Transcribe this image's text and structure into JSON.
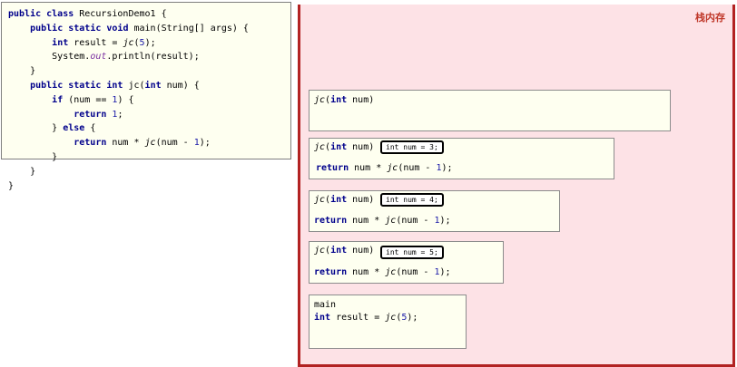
{
  "code": {
    "lines": [
      "public class RecursionDemo1 {",
      "    public static void main(String[] args) {",
      "        int result = jc(5);",
      "        System.out.println(result);",
      "    }",
      "    public static int jc(int num) {",
      "        if (num == 1) {",
      "            return 1;",
      "        } else {",
      "            return num * jc(num - 1);",
      "        }",
      "    }",
      "}"
    ]
  },
  "stack": {
    "label": "栈内存",
    "frames": [
      {
        "header": "jc(int num)",
        "local": "",
        "body": ""
      },
      {
        "header": "jc(int num)",
        "local": "int num = 3;",
        "body": "return num * jc(num - 1);"
      },
      {
        "header": "jc(int num)",
        "local": "int num = 4;",
        "body": "return num * jc(num - 1);"
      },
      {
        "header": "jc(int num)",
        "local": "int num = 5;",
        "body": "return num * jc(num - 1);"
      },
      {
        "header": "main",
        "local": "",
        "body": "int result = jc(5);"
      }
    ]
  },
  "colors": {
    "stack_background": "#fde2e6",
    "stack_border": "#b22222",
    "frame_background": "#fefff0",
    "keyword": "#00008b"
  }
}
